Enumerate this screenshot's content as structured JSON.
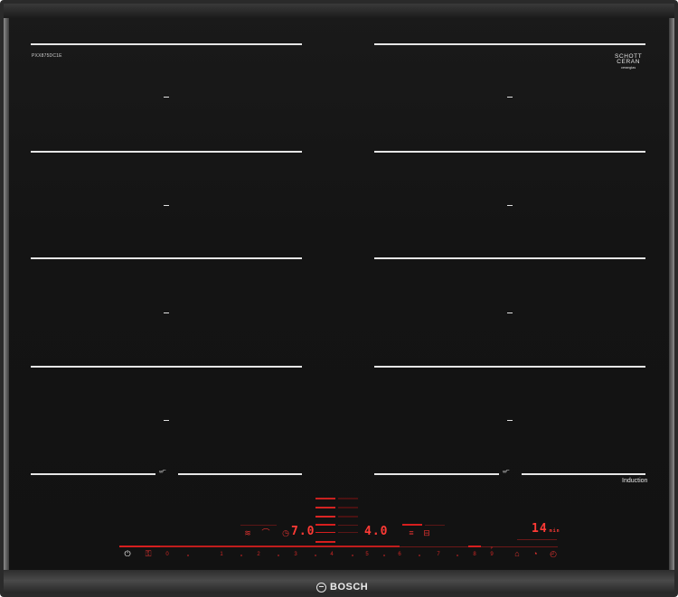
{
  "model_number": "PXX875DC1E",
  "glass_brand": {
    "line1": "SCHOTT",
    "line2": "CERAN",
    "line3": "ceranglas"
  },
  "induction_label": "Induction",
  "bridge_symbol": "↔",
  "brand": "BOSCH",
  "controls": {
    "left_display": "7.0",
    "middle_display": "4.0",
    "timer_display": "14",
    "timer_unit": "min",
    "power_scale": [
      "0",
      "1",
      "2",
      "3",
      "4",
      "5",
      "6",
      "7",
      "8",
      "9"
    ],
    "power_scale_extra": "P"
  },
  "icons": {
    "power": "power-icon",
    "child_lock": "child-lock-icon",
    "fry_sensor": "fry-sensor-icon",
    "move_mode": "move-mode-icon",
    "timer": "timer-icon",
    "stopwatch": "stopwatch-icon",
    "pan": "pan-icon",
    "pot": "pot-icon",
    "bell": "bell-icon"
  },
  "colors": {
    "glass": "#141414",
    "zone_lines": "#e6e6e6",
    "control_red": "#e8282a",
    "frame_steel": "#8a8a8a"
  }
}
